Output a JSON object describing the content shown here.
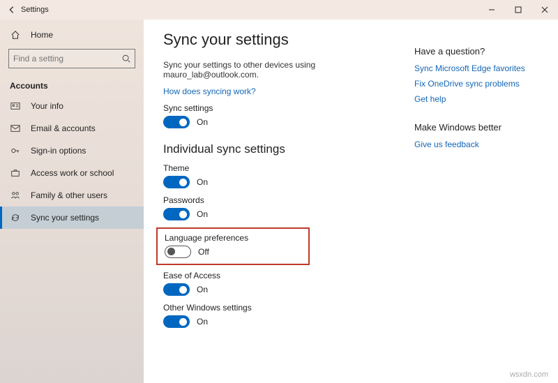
{
  "window": {
    "title": "Settings"
  },
  "sidebar": {
    "home": "Home",
    "search_placeholder": "Find a setting",
    "section": "Accounts",
    "items": [
      {
        "label": "Your info"
      },
      {
        "label": "Email & accounts"
      },
      {
        "label": "Sign-in options"
      },
      {
        "label": "Access work or school"
      },
      {
        "label": "Family & other users"
      },
      {
        "label": "Sync your settings"
      }
    ]
  },
  "main": {
    "title": "Sync your settings",
    "desc": "Sync your settings to other devices using mauro_lab@outlook.com.",
    "link": "How does syncing work?",
    "sync_settings": {
      "label": "Sync settings",
      "state": "On"
    },
    "individual_title": "Individual sync settings",
    "settings": [
      {
        "label": "Theme",
        "state": "On"
      },
      {
        "label": "Passwords",
        "state": "On"
      },
      {
        "label": "Language preferences",
        "state": "Off"
      },
      {
        "label": "Ease of Access",
        "state": "On"
      },
      {
        "label": "Other Windows settings",
        "state": "On"
      }
    ]
  },
  "aside": {
    "q_title": "Have a question?",
    "q_links": [
      "Sync Microsoft Edge favorites",
      "Fix OneDrive sync problems",
      "Get help"
    ],
    "fb_title": "Make Windows better",
    "fb_link": "Give us feedback"
  },
  "watermark": "wsxdn.com"
}
